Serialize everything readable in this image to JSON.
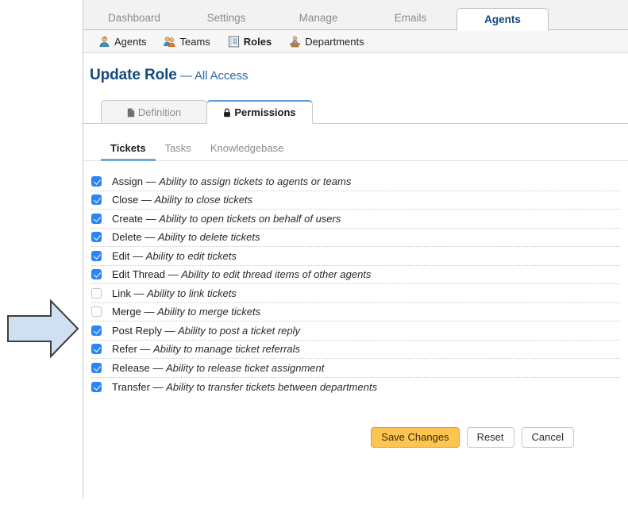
{
  "primary_tabs": [
    {
      "label": "Dashboard",
      "active": false
    },
    {
      "label": "Settings",
      "active": false
    },
    {
      "label": "Manage",
      "active": false
    },
    {
      "label": "Emails",
      "active": false
    },
    {
      "label": "Agents",
      "active": true
    }
  ],
  "secondary_nav": [
    {
      "label": "Agents",
      "icon": "agent-person-icon",
      "active": false
    },
    {
      "label": "Teams",
      "icon": "team-people-icon",
      "active": false
    },
    {
      "label": "Roles",
      "icon": "roles-list-icon",
      "active": true
    },
    {
      "label": "Departments",
      "icon": "department-desk-icon",
      "active": false
    }
  ],
  "page": {
    "title": "Update Role",
    "separator": "—",
    "subtitle": "All Access"
  },
  "section_tabs": [
    {
      "label": "Definition",
      "icon": "document-icon",
      "active": false
    },
    {
      "label": "Permissions",
      "icon": "lock-icon",
      "active": true
    }
  ],
  "inner_tabs": [
    {
      "label": "Tickets",
      "active": true
    },
    {
      "label": "Tasks",
      "active": false
    },
    {
      "label": "Knowledgebase",
      "active": false
    }
  ],
  "permissions": [
    {
      "name": "Assign",
      "separator": "—",
      "description": "Ability to assign tickets to agents or teams",
      "checked": true
    },
    {
      "name": "Close",
      "separator": "—",
      "description": "Ability to close tickets",
      "checked": true
    },
    {
      "name": "Create",
      "separator": "—",
      "description": "Ability to open tickets on behalf of users",
      "checked": true
    },
    {
      "name": "Delete",
      "separator": "—",
      "description": "Ability to delete tickets",
      "checked": true
    },
    {
      "name": "Edit",
      "separator": "—",
      "description": "Ability to edit tickets",
      "checked": true
    },
    {
      "name": "Edit Thread",
      "separator": "—",
      "description": "Ability to edit thread items of other agents",
      "checked": true
    },
    {
      "name": "Link",
      "separator": "—",
      "description": "Ability to link tickets",
      "checked": false
    },
    {
      "name": "Merge",
      "separator": "—",
      "description": "Ability to merge tickets",
      "checked": false
    },
    {
      "name": "Post Reply",
      "separator": "—",
      "description": "Ability to post a ticket reply",
      "checked": true
    },
    {
      "name": "Refer",
      "separator": "—",
      "description": "Ability to manage ticket referrals",
      "checked": true
    },
    {
      "name": "Release",
      "separator": "—",
      "description": "Ability to release ticket assignment",
      "checked": true
    },
    {
      "name": "Transfer",
      "separator": "—",
      "description": "Ability to transfer tickets between departments",
      "checked": true
    }
  ],
  "actions": [
    {
      "label": "Save Changes",
      "style": "primary"
    },
    {
      "label": "Reset",
      "style": "default"
    },
    {
      "label": "Cancel",
      "style": "default"
    }
  ],
  "annotation": {
    "shape": "right-arrow",
    "fill": "#cfe0f2",
    "stroke": "#3f3f3f"
  },
  "colors": {
    "accent_blue": "#14487e",
    "checkbox_on": "#2d84f5",
    "primary_button": "#fcc451",
    "primary_button_border": "#e5a120",
    "tab_underline": "#6fa8dc"
  }
}
